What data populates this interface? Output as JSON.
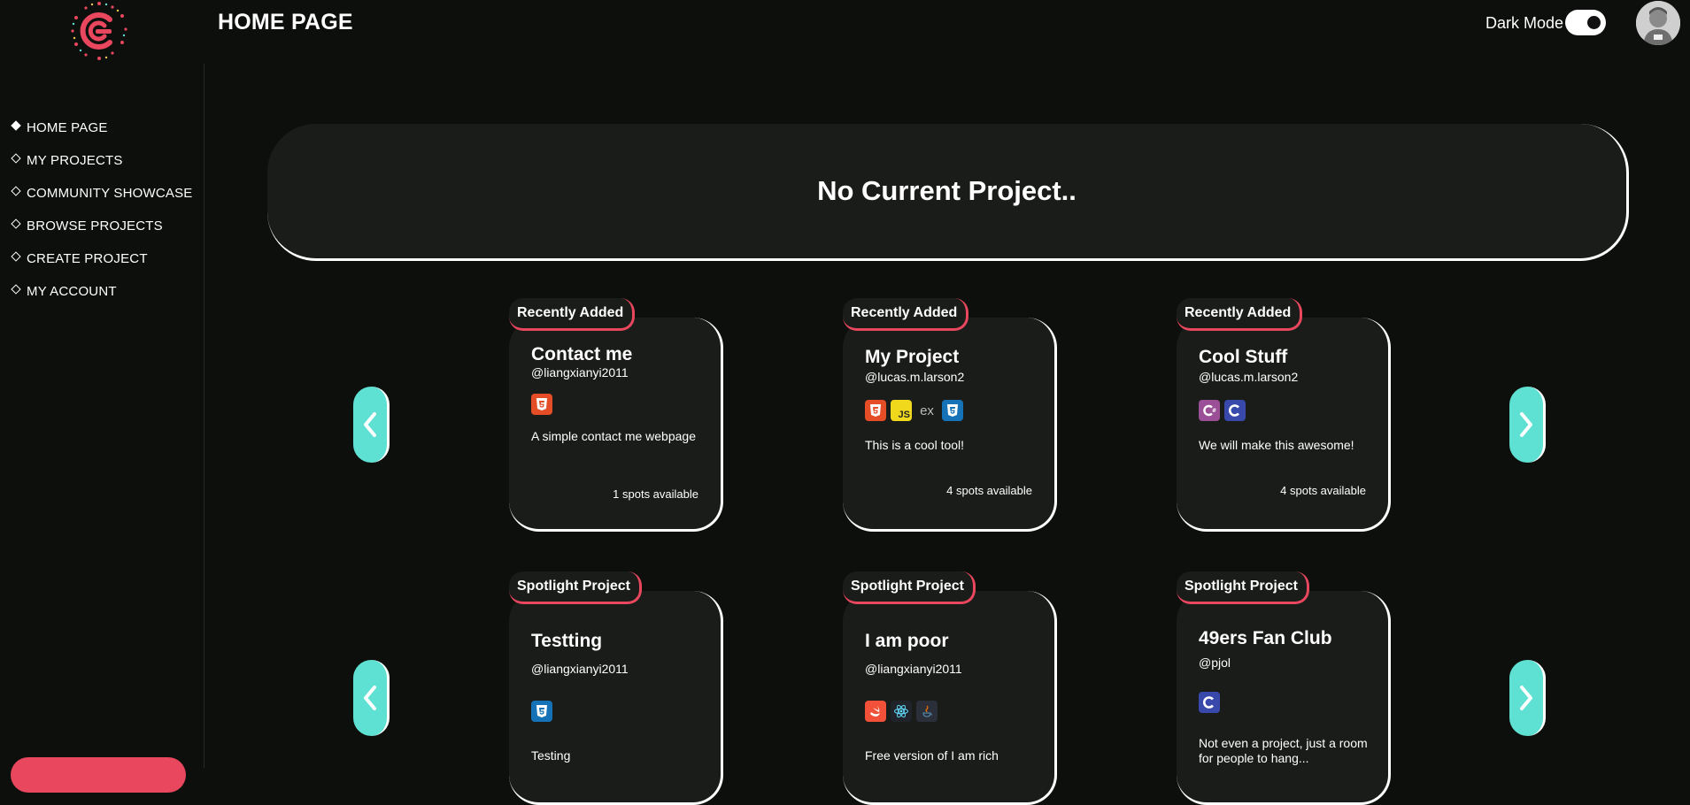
{
  "header": {
    "title": "HOME PAGE",
    "dark_mode_label": "Dark Mode"
  },
  "sidebar": {
    "items": [
      {
        "label": "HOME PAGE"
      },
      {
        "label": "MY PROJECTS"
      },
      {
        "label": "COMMUNITY SHOWCASE"
      },
      {
        "label": "BROWSE PROJECTS"
      },
      {
        "label": "CREATE PROJECT"
      },
      {
        "label": "MY ACCOUNT"
      }
    ]
  },
  "current_project": {
    "text": "No Current Project.."
  },
  "recent": [
    {
      "badge": "Recently Added",
      "title": "Contact me",
      "user": "@liangxianyi2011",
      "desc": "A simple contact me webpage",
      "spots": "1 spots available"
    },
    {
      "badge": "Recently Added",
      "title": "My Project",
      "user": "@lucas.m.larson2",
      "desc": "This is a cool tool!",
      "spots": "4 spots available"
    },
    {
      "badge": "Recently Added",
      "title": "Cool Stuff",
      "user": "@lucas.m.larson2",
      "desc": "We will make this awesome!",
      "spots": "4 spots available"
    }
  ],
  "spotlight": [
    {
      "badge": "Spotlight Project",
      "title": "Testting",
      "user": "@liangxianyi2011",
      "desc": "Testing"
    },
    {
      "badge": "Spotlight Project",
      "title": "I am poor",
      "user": "@liangxianyi2011",
      "desc": "Free version of I am rich"
    },
    {
      "badge": "Spotlight Project",
      "title": "49ers Fan Club",
      "user": "@pjol",
      "desc": "Not even a project, just a room for people to hang..."
    }
  ],
  "tech_icons": {
    "js": "JS",
    "express": "ex"
  },
  "colors": {
    "accent_red": "#e8475e",
    "arrow_teal": "#5ee0d2",
    "card_bg": "#1a1c19",
    "page_bg": "#0d0f0c"
  }
}
